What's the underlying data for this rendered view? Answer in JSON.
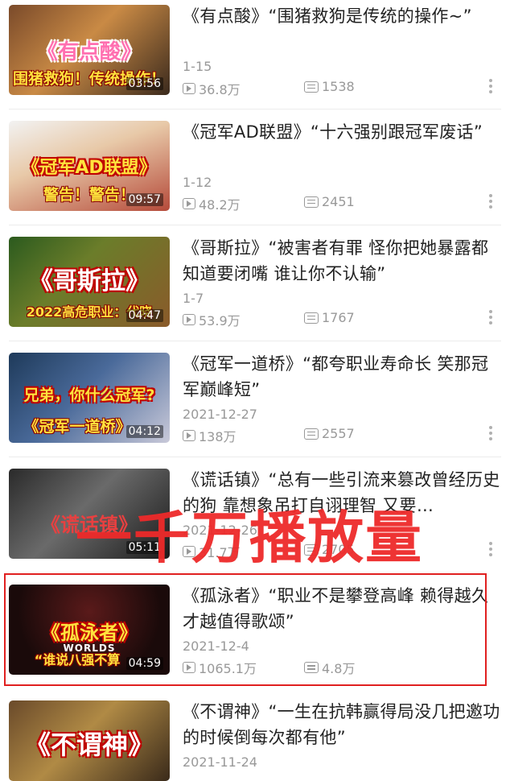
{
  "colors": {
    "accent": "#e02020",
    "text": "#222222",
    "meta": "#999999"
  },
  "videos": [
    {
      "title": "《有点酸》“围猪救狗是传统的操作~”",
      "date": "1-15",
      "views": "36.8万",
      "danmaku": "1538",
      "duration": "03:56",
      "thumb_text": "围猪救狗！传统操作！",
      "thumb_big": "《有点酸》"
    },
    {
      "title": "《冠军AD联盟》“十六强别跟冠军废话”",
      "date": "1-12",
      "views": "48.2万",
      "danmaku": "2451",
      "duration": "09:57",
      "thumb_text": "警告！警告！",
      "thumb_big": "《冠军AD联盟》"
    },
    {
      "title": "《哥斯拉》“被害者有罪  怪你把她暴露都知道要闭嘴  谁让你不认输”",
      "date": "1-7",
      "views": "53.9万",
      "danmaku": "1767",
      "duration": "04:47",
      "thumb_text": "2022高危职业：代晓",
      "thumb_big": "《哥斯拉》"
    },
    {
      "title": "《冠军一道桥》“都夸职业寿命长  笑那冠军巅峰短”",
      "date": "2021-12-27",
      "views": "138万",
      "danmaku": "2557",
      "duration": "04:12",
      "thumb_text": "《冠军一道桥》",
      "thumb_big": "兄弟，你什么冠军?"
    },
    {
      "title": "《谎话镇》“总有一些引流来篡改曾经历史的狗  靠想象吊打自诩理智  又要…",
      "date": "2021-12-26",
      "views": "31.7万",
      "danmaku": "2705",
      "duration": "05:11",
      "thumb_text": "",
      "thumb_big": "《谎话镇》"
    },
    {
      "title": "《孤泳者》“职业不是攀登高峰  赖得越久才越值得歌颂”",
      "date": "2021-12-4",
      "views": "1065.1万",
      "danmaku": "4.8万",
      "duration": "04:59",
      "thumb_text": "“谁说八强不算",
      "thumb_big": "《孤泳者》",
      "thumb_sub": "WORLDS"
    },
    {
      "title": "《不谓神》“一生在抗韩赢得局没几把邀功的时候倒每次都有他”",
      "date": "2021-11-24",
      "views": "",
      "danmaku": "",
      "duration": "",
      "thumb_text": "",
      "thumb_big": "《不谓神》"
    }
  ],
  "watermark": "一千万播放量"
}
